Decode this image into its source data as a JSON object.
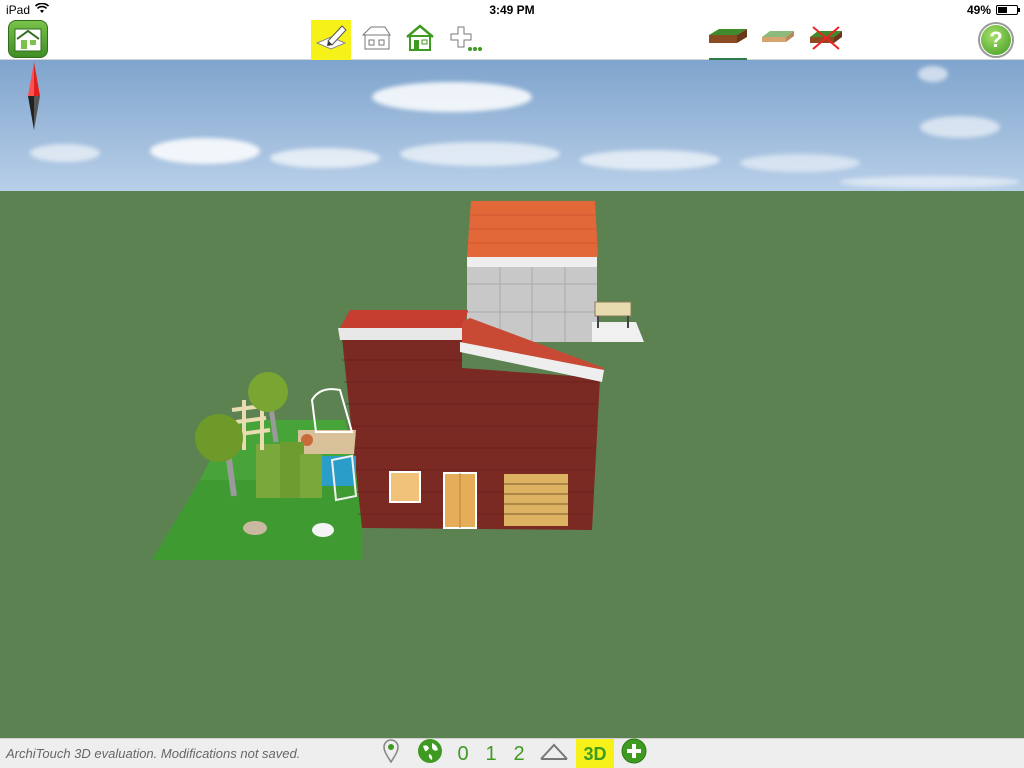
{
  "status_bar": {
    "device": "iPad",
    "time": "3:49 PM",
    "battery": "49%",
    "battery_level": 0.49,
    "icons": [
      "wifi-icon",
      "battery-icon"
    ]
  },
  "toolbar": {
    "app_icon": "architouch-app-icon",
    "tools": [
      {
        "name": "draw-tool",
        "icon": "pencil-plan-icon",
        "active": true
      },
      {
        "name": "roof-tool",
        "icon": "roof-icon",
        "active": false
      },
      {
        "name": "house-tool",
        "icon": "house-icon",
        "active": false
      },
      {
        "name": "add-object-tool",
        "icon": "plus-icon",
        "active": false
      }
    ],
    "terrain_options": [
      {
        "name": "terrain-full",
        "icon": "terrain-block-icon",
        "active": true
      },
      {
        "name": "terrain-flat",
        "icon": "terrain-flat-icon",
        "active": false
      },
      {
        "name": "terrain-none",
        "icon": "terrain-crossed-icon",
        "active": false
      }
    ],
    "help_label": "?"
  },
  "viewport": {
    "compass_icon": "compass-icon",
    "scene": "3d-house-view"
  },
  "bottom_bar": {
    "message": "ArchiTouch 3D evaluation. Modifications not saved.",
    "buttons": [
      {
        "name": "location-button",
        "icon": "map-pin-icon"
      },
      {
        "name": "globe-button",
        "icon": "globe-icon"
      },
      {
        "name": "level-0-button",
        "label": "0"
      },
      {
        "name": "level-1-button",
        "label": "1"
      },
      {
        "name": "level-2-button",
        "label": "2"
      },
      {
        "name": "roof-level-button",
        "icon": "roof-outline-icon"
      },
      {
        "name": "view-3d-button",
        "label": "3D",
        "active": true
      },
      {
        "name": "add-level-button",
        "icon": "plus-circle-icon"
      }
    ]
  },
  "colors": {
    "accent_yellow": "#f6f219",
    "green": "#3f9a22",
    "ground": "#5c8252",
    "brick": "#7a2a22",
    "roof": "#e0683a"
  }
}
